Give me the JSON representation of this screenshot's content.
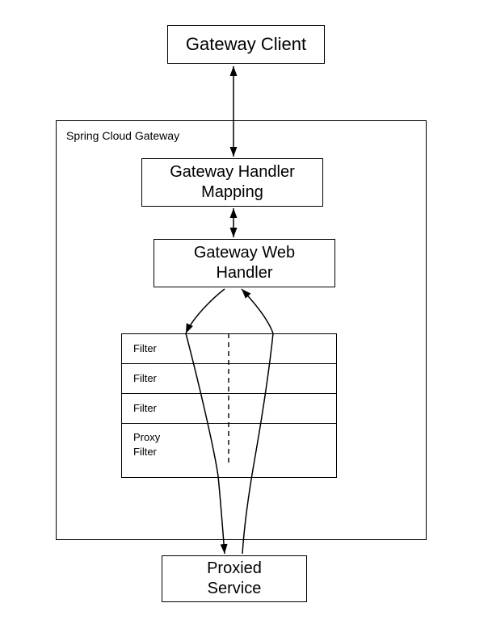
{
  "client": {
    "label": "Gateway Client"
  },
  "container": {
    "label": "Spring Cloud Gateway"
  },
  "handler_mapping": {
    "line1": "Gateway Handler",
    "line2": "Mapping"
  },
  "web_handler": {
    "line1": "Gateway Web",
    "line2": "Handler"
  },
  "filters": {
    "rows": [
      {
        "label": "Filter"
      },
      {
        "label": "Filter"
      },
      {
        "label": "Filter"
      },
      {
        "label": "Proxy\nFilter"
      }
    ]
  },
  "proxied": {
    "line1": "Proxied",
    "line2": "Service"
  }
}
